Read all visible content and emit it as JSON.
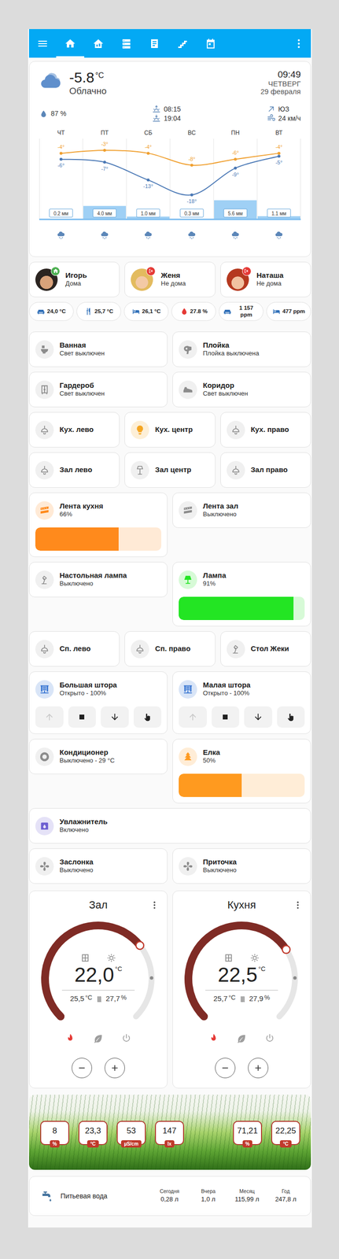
{
  "header": {
    "tabs": [
      {
        "kind": "home",
        "selected": true
      },
      {
        "kind": "house",
        "selected": false
      },
      {
        "kind": "server",
        "selected": false
      },
      {
        "kind": "note",
        "selected": false
      },
      {
        "kind": "stairs",
        "selected": false
      },
      {
        "kind": "calendar",
        "selected": false
      }
    ]
  },
  "weather": {
    "temperature": "-5.8",
    "unit": "°C",
    "condition": "Облачно",
    "time": "09:49",
    "weekday": "ЧЕТВЕРГ",
    "date": "29 февраля",
    "humidity": "87 %",
    "sunrise": "08:15",
    "sunset": "19:04",
    "wind_direction": "ЮЗ",
    "wind_speed": "24 км/ч",
    "forecast": {
      "days": [
        "ЧТ",
        "ПТ",
        "СБ",
        "ВС",
        "ПН",
        "ВТ"
      ],
      "high": [
        -4,
        -3,
        -4,
        -8,
        -6,
        -4
      ],
      "high_labels": [
        "-4°",
        "-3°",
        "-4°",
        "-8°",
        "-6°",
        "-4°"
      ],
      "low": [
        -6,
        -7,
        -13,
        -18,
        -9,
        -5
      ],
      "low_labels": [
        "-6°",
        "-7°",
        "-13°",
        "-18°",
        "-9°",
        "-5°"
      ],
      "precipitation": [
        0.2,
        4.0,
        1.0,
        0.3,
        5.6,
        1.1
      ],
      "precipitation_labels": [
        "0.2 мм",
        "4.0 мм",
        "1.0 мм",
        "0.3 мм",
        "5.6 мм",
        "1.1 мм"
      ],
      "kinds": [
        "snowy",
        "snowy",
        "snowy",
        "snowy",
        "snowy",
        "snowy"
      ]
    }
  },
  "people": [
    {
      "name": "Игорь",
      "state": "Дома",
      "home": true
    },
    {
      "name": "Женя",
      "state": "Не дома",
      "home": false
    },
    {
      "name": "Наташа",
      "state": "Не дома",
      "home": false
    }
  ],
  "sensors": [
    {
      "kind": "sofa",
      "value": "24,0 °C",
      "color": "#2f6fb8"
    },
    {
      "kind": "dining",
      "value": "25,7 °C",
      "color": "#2f6fb8"
    },
    {
      "kind": "bed",
      "value": "26,1 °C",
      "color": "#2f6fb8"
    },
    {
      "kind": "drop",
      "value": "27.8 %",
      "color": "#e53935"
    },
    {
      "kind": "sofa",
      "value": "1 157 ppm",
      "color": "#2f6fb8"
    },
    {
      "kind": "bed",
      "value": "477 ppm",
      "color": "#2f6fb8"
    }
  ],
  "tile_rows": [
    [
      {
        "name": "Ванная",
        "state": "Свет выключен",
        "on": false,
        "kind": "toilet"
      },
      {
        "name": "Плойка",
        "state": "Плойка выключена",
        "on": false,
        "kind": "hairdryer"
      }
    ],
    [
      {
        "name": "Гардероб",
        "state": "Свет выключен",
        "on": false,
        "kind": "wardrobe"
      },
      {
        "name": "Коридор",
        "state": "Свет выключен",
        "on": false,
        "kind": "shoe"
      }
    ],
    [
      {
        "name": "Кух. лево",
        "on": false,
        "kind": "ceiling"
      },
      {
        "name": "Кух. центр",
        "on": true,
        "kind": "bulb",
        "color": "#f5a623"
      },
      {
        "name": "Кух. право",
        "on": false,
        "kind": "ceiling"
      }
    ],
    [
      {
        "name": "Зал лево",
        "on": false,
        "kind": "ceiling"
      },
      {
        "name": "Зал центр",
        "on": false,
        "kind": "floorlamp"
      },
      {
        "name": "Зал право",
        "on": false,
        "kind": "ceiling"
      }
    ],
    [
      {
        "name": "Лента кухня",
        "state": "66%",
        "on": true,
        "kind": "strip",
        "color": "#ff8a1c",
        "level": 0.66
      },
      {
        "name": "Лента зал",
        "state": "Выключено",
        "on": false,
        "kind": "strip"
      }
    ],
    [
      {
        "name": "Настольная лампа",
        "state": "Выключено",
        "on": false,
        "kind": "desklamp"
      },
      {
        "name": "Лампа",
        "state": "91%",
        "on": true,
        "kind": "lamp",
        "color": "#23e523",
        "level": 0.91
      }
    ],
    [
      {
        "name": "Сп. лево",
        "on": false,
        "kind": "ceiling"
      },
      {
        "name": "Сп. право",
        "on": false,
        "kind": "ceiling"
      },
      {
        "name": "Стол Жеки",
        "on": false,
        "kind": "desklamp"
      }
    ],
    [
      {
        "name": "Большая штора",
        "state": "Открыто - 100%",
        "on": true,
        "kind": "blinds",
        "color": "#2f6fd0",
        "buttons": [
          {
            "kind": "up",
            "disabled": true
          },
          {
            "kind": "stop",
            "disabled": false
          },
          {
            "kind": "down",
            "disabled": false
          },
          {
            "kind": "tilt",
            "disabled": false
          }
        ]
      },
      {
        "name": "Малая штора",
        "state": "Открыто - 100%",
        "on": true,
        "kind": "blinds",
        "color": "#2f6fd0",
        "buttons": [
          {
            "kind": "up",
            "disabled": true
          },
          {
            "kind": "stop",
            "disabled": false
          },
          {
            "kind": "down",
            "disabled": false
          },
          {
            "kind": "tilt",
            "disabled": false
          }
        ]
      }
    ],
    [
      {
        "name": "Кондиционер",
        "state": "Выключено - 29 °C",
        "on": false,
        "kind": "ac"
      },
      {
        "name": "Елка",
        "state": "50%",
        "on": true,
        "kind": "tree",
        "color": "#ff9a1f",
        "level": 0.5
      }
    ],
    [
      {
        "name": "Увлажнитель",
        "state": "Включено",
        "on": true,
        "kind": "humidifier",
        "color": "#6d5fd1"
      }
    ],
    [
      {
        "name": "Заслонка",
        "state": "Выключено",
        "on": false,
        "kind": "fan"
      },
      {
        "name": "Приточка",
        "state": "Выключено",
        "on": false,
        "kind": "fan"
      }
    ]
  ],
  "thermostats": [
    {
      "name": "Зал",
      "target": "22,0",
      "unit": "°C",
      "current": "25,5",
      "current_unit": "°C",
      "humidity": "27,7",
      "humidity_unit": "%",
      "level": 0.69,
      "current_level": 0.83,
      "modes": [
        {
          "kind": "heat",
          "selected": true
        },
        {
          "kind": "eco",
          "selected": false
        },
        {
          "kind": "off",
          "selected": false
        }
      ]
    },
    {
      "name": "Кухня",
      "target": "22,5",
      "unit": "°C",
      "current": "25,7",
      "current_unit": "°C",
      "humidity": "27,9",
      "humidity_unit": "%",
      "level": 0.71,
      "current_level": 0.83,
      "modes": [
        {
          "kind": "heat",
          "selected": true
        },
        {
          "kind": "eco",
          "selected": false
        },
        {
          "kind": "off",
          "selected": false
        }
      ]
    }
  ],
  "plant": {
    "left": [
      {
        "value": "8",
        "unit": "%"
      },
      {
        "value": "23,3",
        "unit": "°C"
      },
      {
        "value": "53",
        "unit": "µS/cm"
      },
      {
        "value": "147",
        "unit": "lx"
      }
    ],
    "right": [
      {
        "value": "71,21",
        "unit": "%"
      },
      {
        "value": "22,25",
        "unit": "°C"
      }
    ]
  },
  "water": {
    "title": "Питьевая вода",
    "stats": [
      {
        "label": "Сегодня",
        "value": "0,28 л"
      },
      {
        "label": "Вчера",
        "value": "1,0 л"
      },
      {
        "label": "Месяц",
        "value": "115,99 л"
      },
      {
        "label": "Год",
        "value": "247,8 л"
      }
    ]
  }
}
